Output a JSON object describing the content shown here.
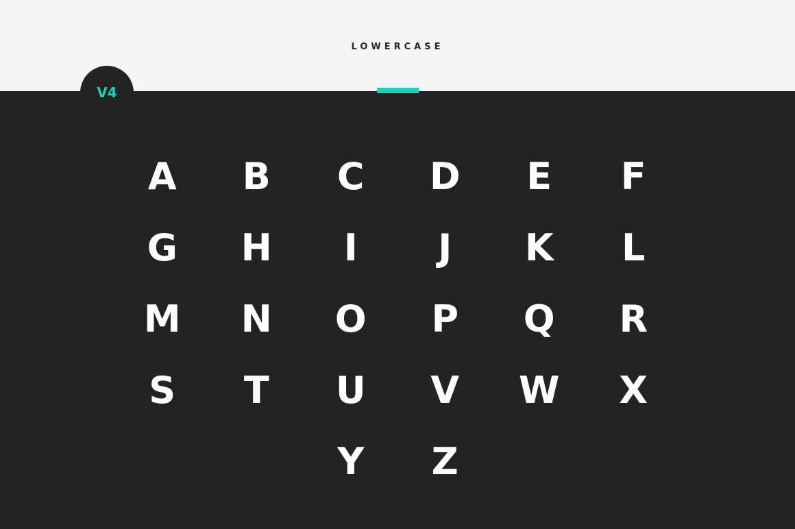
{
  "header": {
    "title": "LOWERCASE"
  },
  "badge": {
    "label": "V4"
  },
  "colors": {
    "accent": "#19d3b4",
    "dark_background": "#232323",
    "light_background": "#f5f5f5",
    "glyph": "#ffffff"
  },
  "glyphs": [
    "A",
    "B",
    "C",
    "D",
    "E",
    "F",
    "G",
    "H",
    "I",
    "J",
    "K",
    "L",
    "M",
    "N",
    "O",
    "P",
    "Q",
    "R",
    "S",
    "T",
    "U",
    "V",
    "W",
    "X",
    "Y",
    "Z"
  ]
}
